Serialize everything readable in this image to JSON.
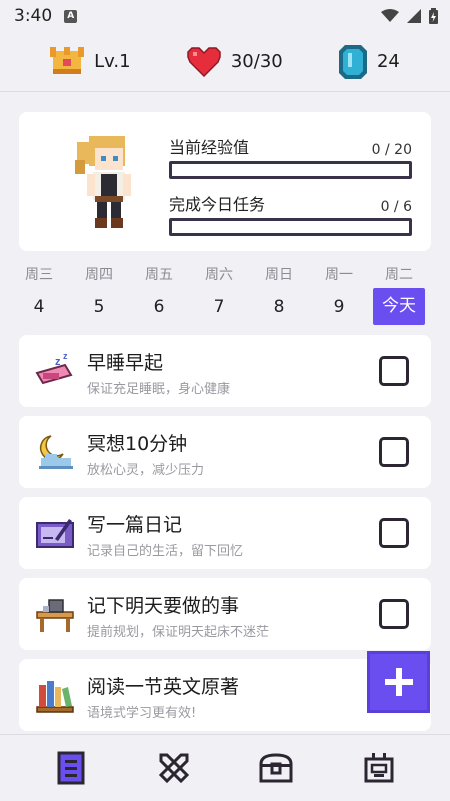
{
  "status_bar": {
    "time": "3:40",
    "notification_badge": "A"
  },
  "top_stats": {
    "level": "Lv.1",
    "health": "30/30",
    "gems": "24"
  },
  "hero": {
    "exp_label": "当前经验值",
    "exp_value": "0 / 20",
    "exp_fraction": 0,
    "task_label": "完成今日任务",
    "task_value": "0 / 6",
    "task_fraction": 0
  },
  "week": [
    {
      "weekday": "周三",
      "day": "4"
    },
    {
      "weekday": "周四",
      "day": "5"
    },
    {
      "weekday": "周五",
      "day": "6"
    },
    {
      "weekday": "周六",
      "day": "7"
    },
    {
      "weekday": "周日",
      "day": "8"
    },
    {
      "weekday": "周一",
      "day": "9"
    },
    {
      "weekday": "周二",
      "day": "今天"
    }
  ],
  "tasks": [
    {
      "title": "早睡早起",
      "subtitle": "保证充足睡眠，身心健康",
      "icon": "sleep-icon",
      "checked": false
    },
    {
      "title": "冥想10分钟",
      "subtitle": "放松心灵，减少压力",
      "icon": "moon-cloud-icon",
      "checked": false
    },
    {
      "title": "写一篇日记",
      "subtitle": "记录自己的生活，留下回忆",
      "icon": "tablet-pen-icon",
      "checked": false
    },
    {
      "title": "记下明天要做的事",
      "subtitle": "提前规划，保证明天起床不迷茫",
      "icon": "desk-icon",
      "checked": false
    },
    {
      "title": "阅读一节英文原著",
      "subtitle": "语境式学习更有效!",
      "icon": "books-icon",
      "checked": false
    }
  ],
  "colors": {
    "accent": "#6b4ef0",
    "background": "#f1f0f4",
    "card": "#ffffff"
  },
  "bottom_nav": [
    "tasks-list-icon",
    "crossed-swords-icon",
    "treasure-chest-icon",
    "robot-icon"
  ]
}
